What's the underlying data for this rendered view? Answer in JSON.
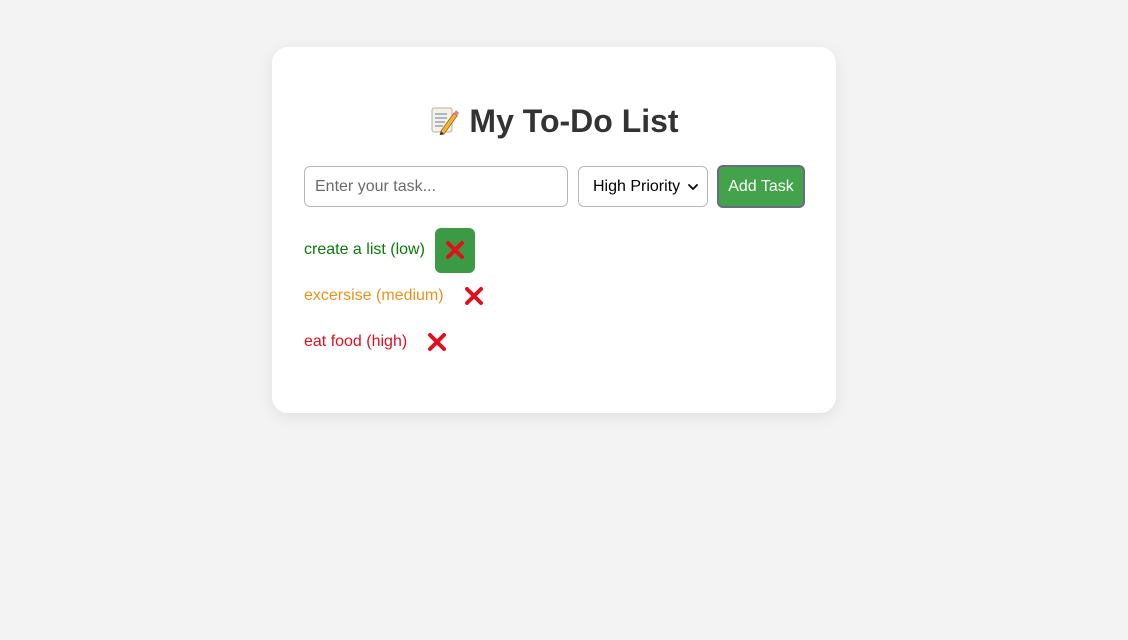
{
  "title": "My To-Do List",
  "title_icon": "memo-icon",
  "input": {
    "placeholder": "Enter your task...",
    "value": ""
  },
  "priority_select": {
    "selected": "High Priority"
  },
  "add_button_label": "Add Task",
  "tasks": [
    {
      "text": "create a list (low)",
      "priority": "low",
      "color": "#0a7a0a",
      "delete_icon": "cross-mark-icon",
      "hovered": true
    },
    {
      "text": "excersise (medium)",
      "priority": "medium",
      "color": "#f0901c",
      "delete_icon": "cross-mark-icon",
      "hovered": false
    },
    {
      "text": "eat food (high)",
      "priority": "high",
      "color": "#e0101e",
      "delete_icon": "cross-mark-icon",
      "hovered": false
    }
  ],
  "colors": {
    "background": "#f3f3f3",
    "card": "#ffffff",
    "accent_green": "#43a34a",
    "delete_red": "#e0101e"
  }
}
